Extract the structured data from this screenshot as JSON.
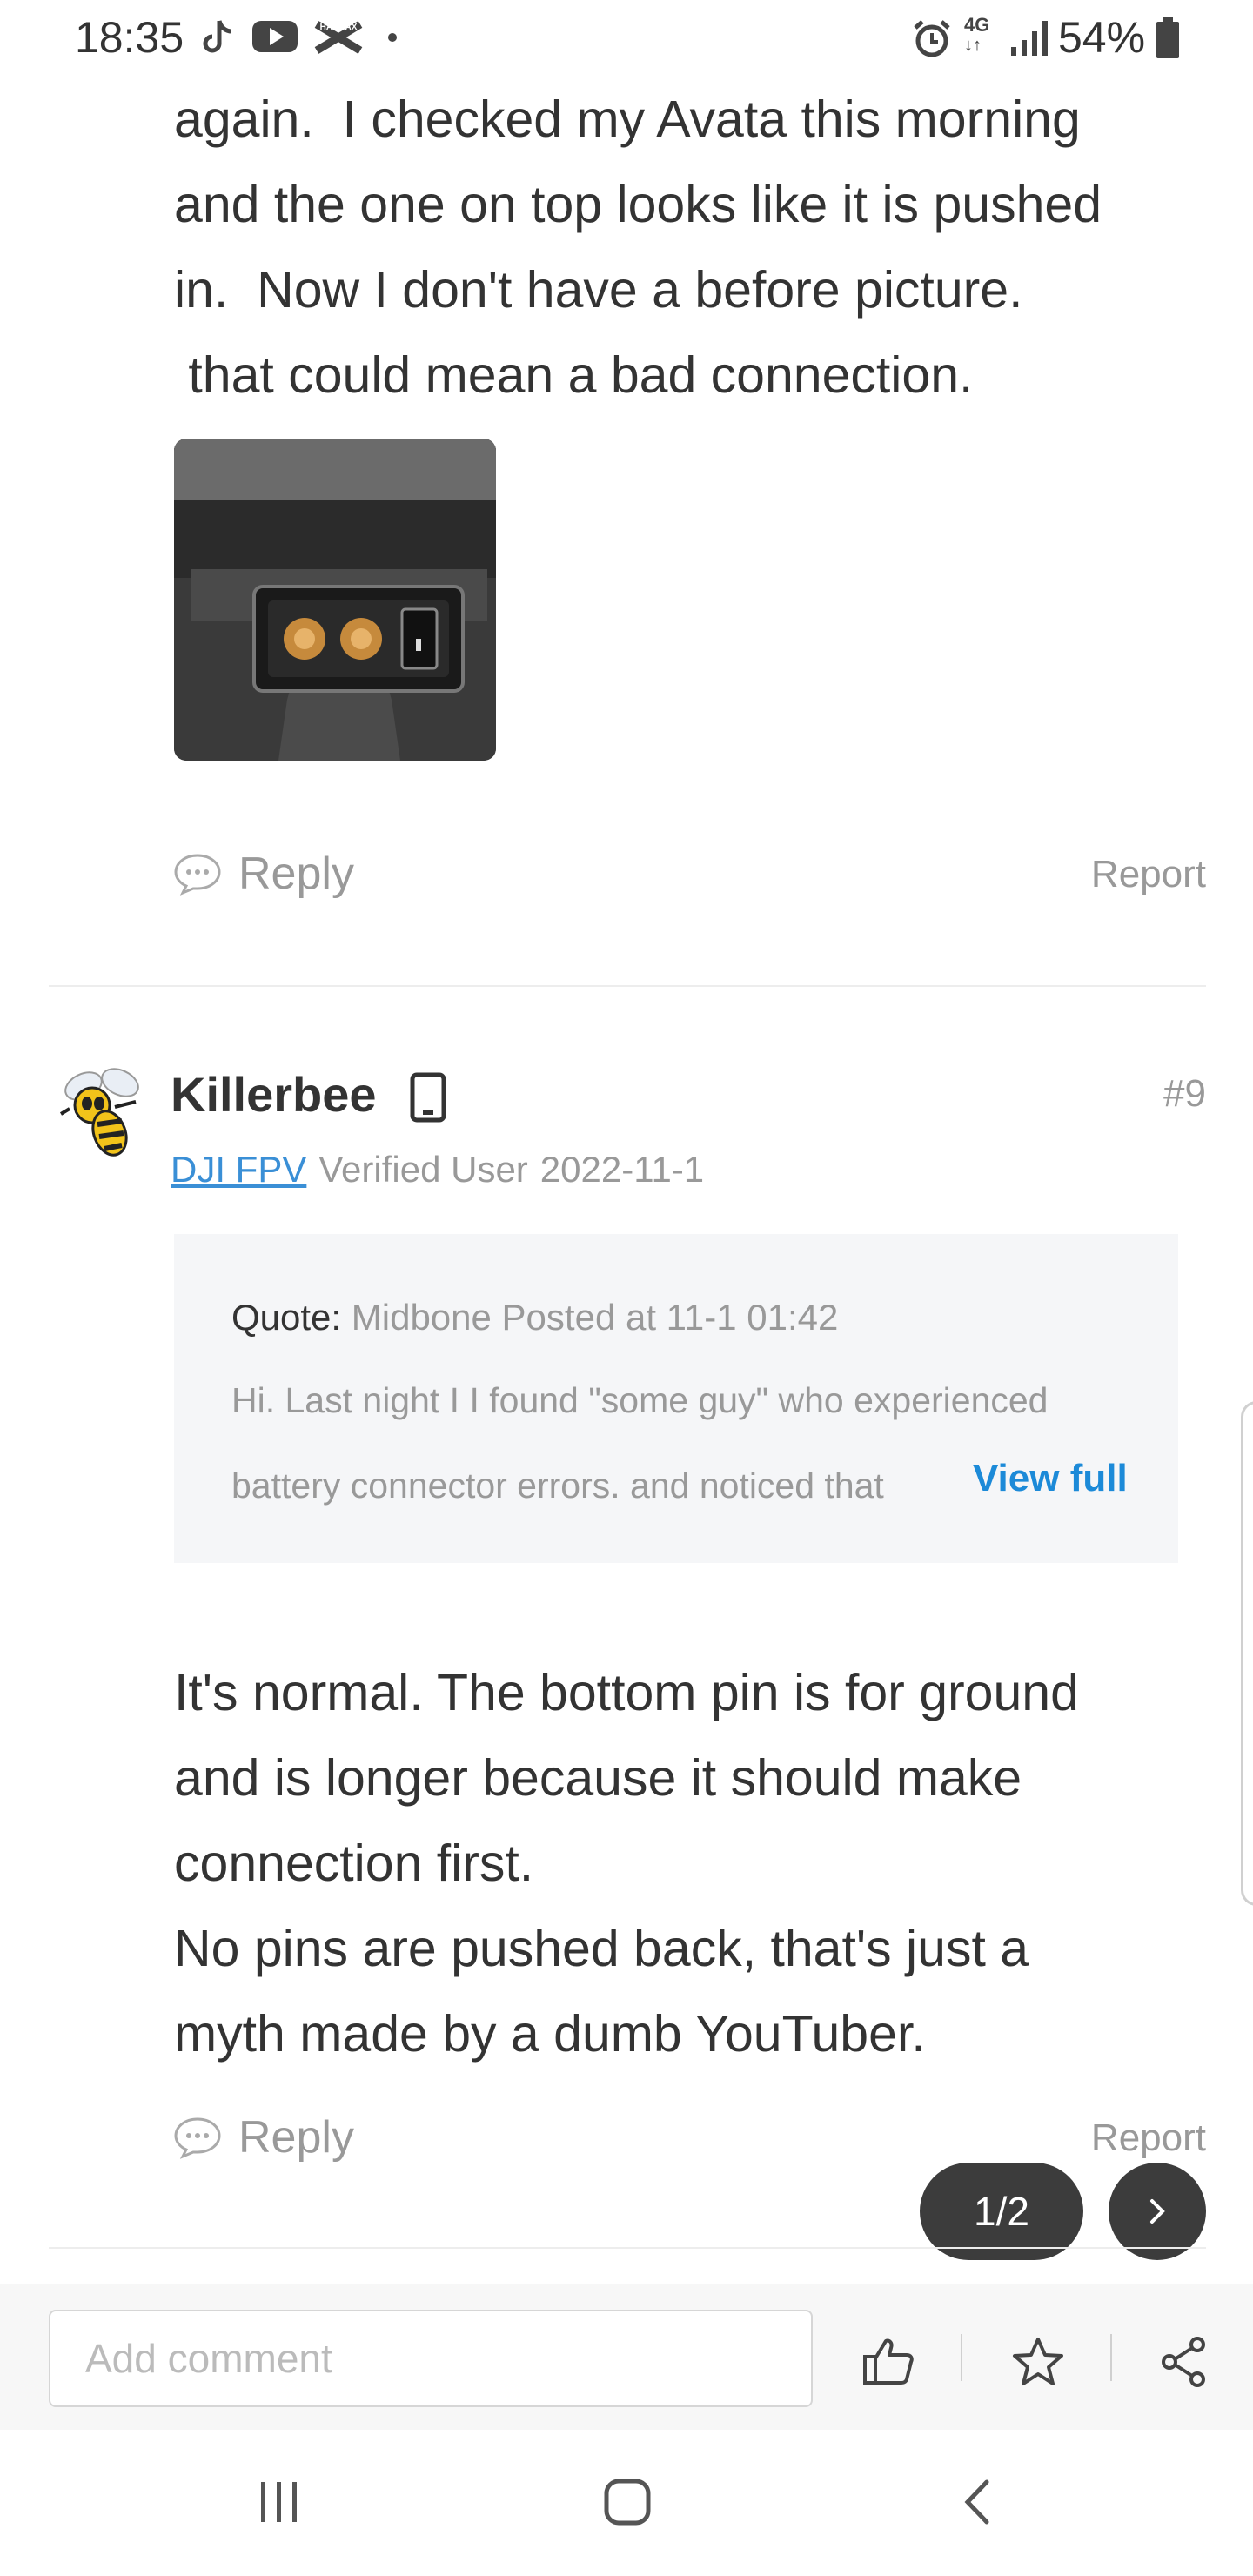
{
  "status_bar": {
    "time": "18:35",
    "left_icons": [
      "tiktok-icon",
      "youtube-icon",
      "halifax-icon",
      "dot-icon"
    ],
    "right_icons": [
      "alarm-icon",
      "network-4g-icon",
      "signal-icon",
      "battery-icon"
    ],
    "network": "4G",
    "battery": "54%"
  },
  "post1": {
    "lines": [
      "again.  I checked my Avata this morning",
      "and the one on top looks like it is pushed",
      "in.  Now I don't have a before picture.",
      " that could mean a bad connection."
    ],
    "reply_label": "Reply",
    "report_label": "Report"
  },
  "post2": {
    "author": "Killerbee",
    "number": "#9",
    "tag": "DJI FPV",
    "verified": "Verified User",
    "date": "2022-11-1",
    "quote": {
      "label": "Quote:",
      "meta": "Midbone Posted at 11-1 01:42",
      "line1": "Hi.  Last night I I found \"some guy\" who experienced",
      "line2": "battery connector errors.  and noticed that",
      "view_full": "View full"
    },
    "lines": [
      "It's normal. The bottom pin is for ground",
      "and is longer because it should make",
      "connection first.",
      "No pins are pushed back, that's just a",
      "myth made by a dumb YouTuber."
    ],
    "reply_label": "Reply",
    "report_label": "Report"
  },
  "pager": {
    "label": "1/2"
  },
  "comment_bar": {
    "placeholder": "Add comment",
    "icons": [
      "thumbs-up-icon",
      "star-icon",
      "share-icon"
    ]
  },
  "nav_bar": {
    "icons": [
      "recent-apps-icon",
      "home-icon",
      "back-icon"
    ]
  },
  "colors": {
    "link": "#1c8ad8",
    "tag": "#3a8fd6",
    "muted": "#999999",
    "text": "#333333",
    "pager": "#3c3c3c"
  }
}
